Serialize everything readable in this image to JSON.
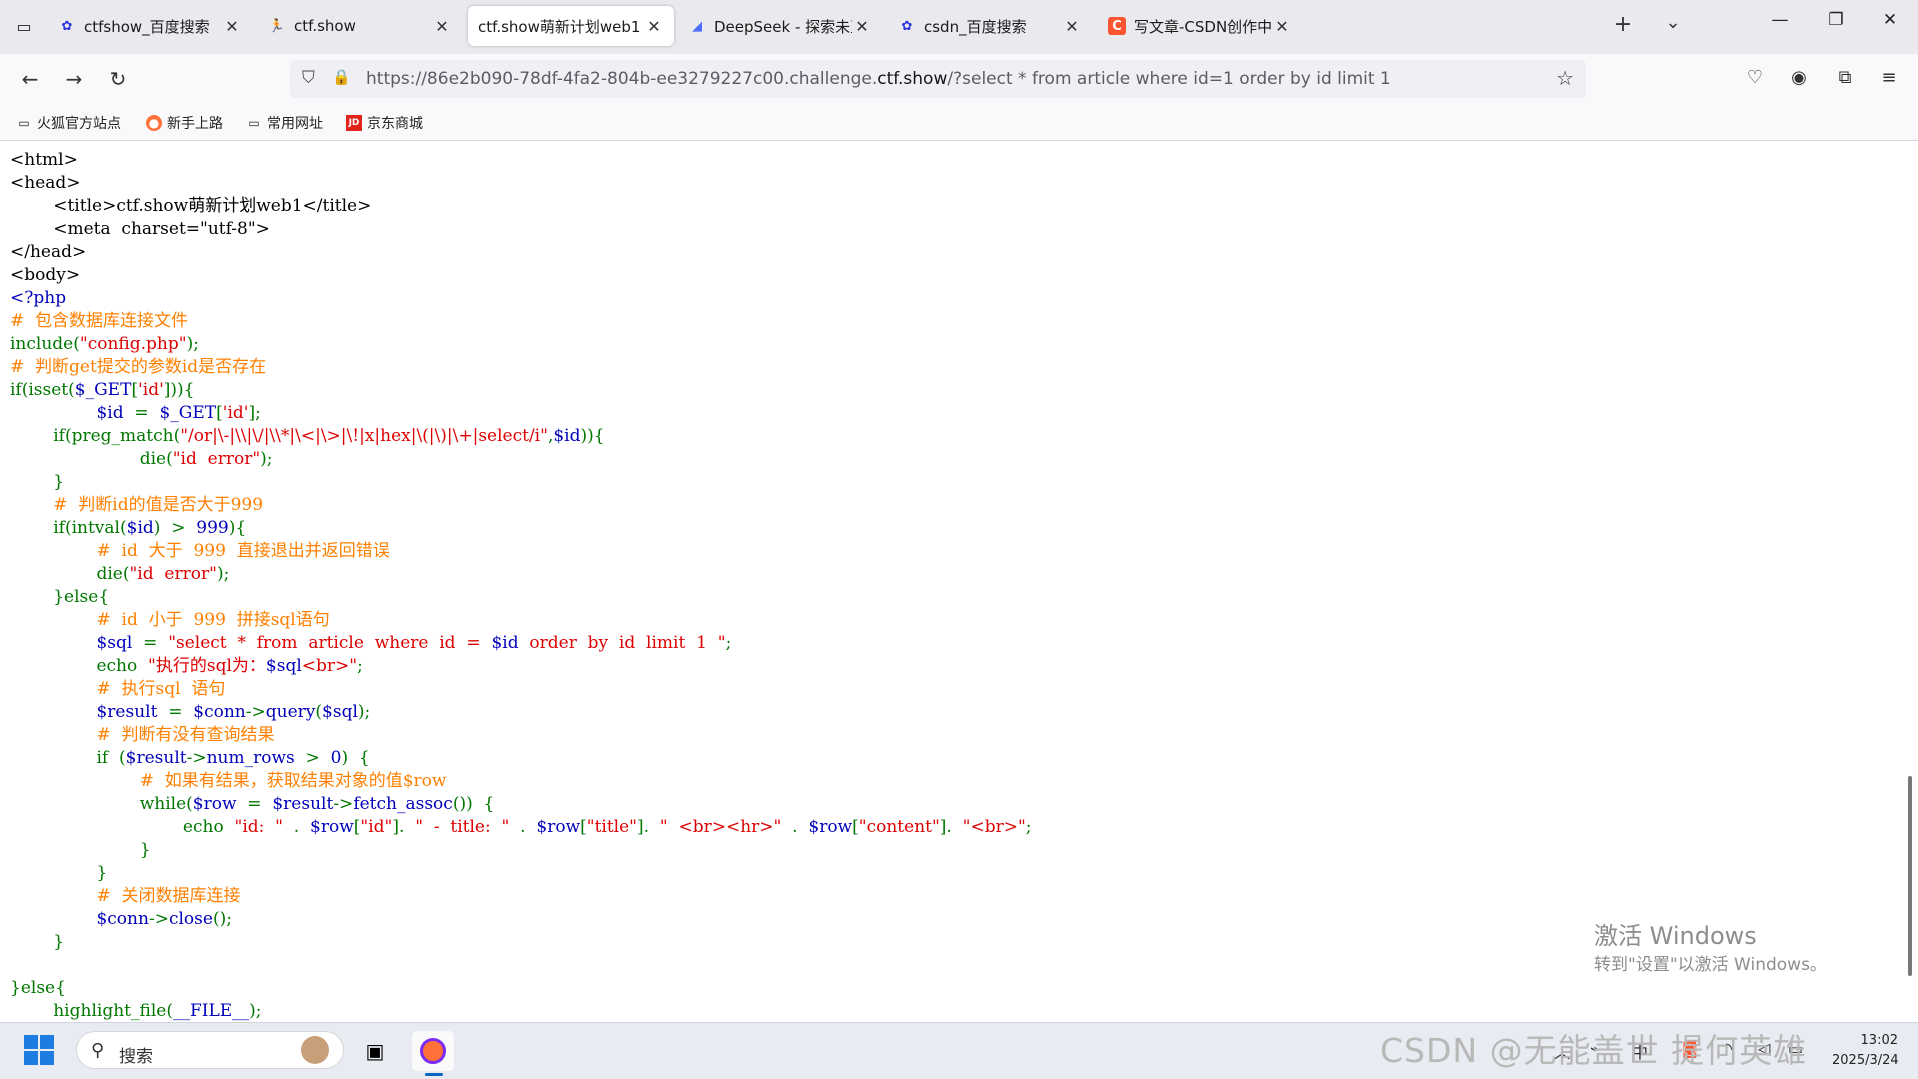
{
  "tabs": [
    {
      "title": "ctfshow_百度搜索",
      "icon": "baidu-paw-icon",
      "active": false
    },
    {
      "title": "ctf.show",
      "icon": "ctfshow-runner-icon",
      "active": false
    },
    {
      "title": "ctf.show萌新计划web1",
      "icon": "",
      "active": true
    },
    {
      "title": "DeepSeek - 探索未至之境",
      "icon": "deepseek-whale-icon",
      "active": false
    },
    {
      "title": "csdn_百度搜索",
      "icon": "baidu-paw-icon",
      "active": false
    },
    {
      "title": "写文章-CSDN创作中心",
      "icon": "csdn-c-icon",
      "active": false
    }
  ],
  "url": {
    "prefix": "https://86e2b090-78df-4fa2-804b-ee3279227c00.challenge.",
    "domain": "ctf.show",
    "suffix": "/?select * from article where id=1 order by id limit 1"
  },
  "bookmarks": [
    {
      "label": "火狐官方站点",
      "icon": "folder-icon"
    },
    {
      "label": "新手上路",
      "icon": "firefox-icon"
    },
    {
      "label": "常用网址",
      "icon": "folder-icon"
    },
    {
      "label": "京东商城",
      "icon": "jd-icon"
    }
  ],
  "code_lines": [
    [
      [
        "def",
        "<html>"
      ]
    ],
    [
      [
        "def",
        "<head>"
      ]
    ],
    [
      [
        "def",
        "        <title>ctf.show萌新计划web1</title>"
      ]
    ],
    [
      [
        "def",
        "        <meta  charset=\"utf-8\">"
      ]
    ],
    [
      [
        "def",
        "</head>"
      ]
    ],
    [
      [
        "def",
        "<body>"
      ]
    ],
    [
      [
        "var",
        "<?php"
      ]
    ],
    [
      [
        "cmt",
        "#  包含数据库连接文件"
      ]
    ],
    [
      [
        "kw",
        "include("
      ],
      [
        "str",
        "\"config.php\""
      ],
      [
        "kw",
        ");"
      ]
    ],
    [
      [
        "cmt",
        "#  判断get提交的参数id是否存在"
      ]
    ],
    [
      [
        "kw",
        "if(isset("
      ],
      [
        "var",
        "$_GET"
      ],
      [
        "kw",
        "["
      ],
      [
        "str",
        "'id'"
      ],
      [
        "kw",
        "])){"
      ]
    ],
    [
      [
        "kw",
        "                "
      ],
      [
        "var",
        "$id"
      ],
      [
        "kw",
        "  =  "
      ],
      [
        "var",
        "$_GET"
      ],
      [
        "kw",
        "["
      ],
      [
        "str",
        "'id'"
      ],
      [
        "kw",
        "];"
      ]
    ],
    [
      [
        "kw",
        "        if(preg_match("
      ],
      [
        "str",
        "\"/or|\\-|\\\\|\\/|\\\\*|\\<|\\>|\\!|x|hex|\\(|\\)|\\+|select/i\""
      ],
      [
        "kw",
        ","
      ],
      [
        "var",
        "$id"
      ],
      [
        "kw",
        ")){"
      ]
    ],
    [
      [
        "kw",
        "                        die("
      ],
      [
        "str",
        "\"id  error\""
      ],
      [
        "kw",
        ");"
      ]
    ],
    [
      [
        "kw",
        "        }"
      ]
    ],
    [
      [
        "cmt",
        "        #  判断id的值是否大于999"
      ]
    ],
    [
      [
        "kw",
        "        if(intval("
      ],
      [
        "var",
        "$id"
      ],
      [
        "kw",
        ")  >  "
      ],
      [
        "var",
        "999"
      ],
      [
        "kw",
        "){"
      ]
    ],
    [
      [
        "cmt",
        "                #  id  大于  999  直接退出并返回错误"
      ]
    ],
    [
      [
        "kw",
        "                die("
      ],
      [
        "str",
        "\"id  error\""
      ],
      [
        "kw",
        ");"
      ]
    ],
    [
      [
        "kw",
        "        }else{"
      ]
    ],
    [
      [
        "cmt",
        "                #  id  小于  999  拼接sql语句"
      ]
    ],
    [
      [
        "kw",
        "                "
      ],
      [
        "var",
        "$sql"
      ],
      [
        "kw",
        "  =  "
      ],
      [
        "str",
        "\"select  *  from  article  where  id  =  "
      ],
      [
        "var",
        "$id"
      ],
      [
        "str",
        "  order  by  id  limit  1  \""
      ],
      [
        "kw",
        ";"
      ]
    ],
    [
      [
        "kw",
        "                echo  "
      ],
      [
        "str",
        "\"执行的sql为："
      ],
      [
        "var",
        "$sql"
      ],
      [
        "str",
        "<br>\""
      ],
      [
        "kw",
        ";"
      ]
    ],
    [
      [
        "cmt",
        "                #  执行sql  语句"
      ]
    ],
    [
      [
        "kw",
        "                "
      ],
      [
        "var",
        "$result"
      ],
      [
        "kw",
        "  =  "
      ],
      [
        "var",
        "$conn"
      ],
      [
        "kw",
        "->"
      ],
      [
        "var",
        "query"
      ],
      [
        "kw",
        "("
      ],
      [
        "var",
        "$sql"
      ],
      [
        "kw",
        ");"
      ]
    ],
    [
      [
        "cmt",
        "                #  判断有没有查询结果"
      ]
    ],
    [
      [
        "kw",
        "                if  ("
      ],
      [
        "var",
        "$result"
      ],
      [
        "kw",
        "->"
      ],
      [
        "var",
        "num_rows"
      ],
      [
        "kw",
        "  >  "
      ],
      [
        "var",
        "0"
      ],
      [
        "kw",
        ")  {"
      ]
    ],
    [
      [
        "cmt",
        "                        #  如果有结果，获取结果对象的值$row"
      ]
    ],
    [
      [
        "kw",
        "                        while("
      ],
      [
        "var",
        "$row"
      ],
      [
        "kw",
        "  =  "
      ],
      [
        "var",
        "$result"
      ],
      [
        "kw",
        "->"
      ],
      [
        "var",
        "fetch_assoc"
      ],
      [
        "kw",
        "())  {"
      ]
    ],
    [
      [
        "kw",
        "                                echo  "
      ],
      [
        "str",
        "\"id:  \""
      ],
      [
        "kw",
        "  .  "
      ],
      [
        "var",
        "$row"
      ],
      [
        "kw",
        "["
      ],
      [
        "str",
        "\"id\""
      ],
      [
        "kw",
        "].  "
      ],
      [
        "str",
        "\"  -  title:  \""
      ],
      [
        "kw",
        "  .  "
      ],
      [
        "var",
        "$row"
      ],
      [
        "kw",
        "["
      ],
      [
        "str",
        "\"title\""
      ],
      [
        "kw",
        "].  "
      ],
      [
        "str",
        "\"  <br><hr>\""
      ],
      [
        "kw",
        "  .  "
      ],
      [
        "var",
        "$row"
      ],
      [
        "kw",
        "["
      ],
      [
        "str",
        "\"content\""
      ],
      [
        "kw",
        "].  "
      ],
      [
        "str",
        "\"<br>\""
      ],
      [
        "kw",
        ";"
      ]
    ],
    [
      [
        "kw",
        "                        }"
      ]
    ],
    [
      [
        "kw",
        "                }"
      ]
    ],
    [
      [
        "cmt",
        "                #  关闭数据库连接"
      ]
    ],
    [
      [
        "kw",
        "                "
      ],
      [
        "var",
        "$conn"
      ],
      [
        "kw",
        "->"
      ],
      [
        "var",
        "close"
      ],
      [
        "kw",
        "();"
      ]
    ],
    [
      [
        "kw",
        "        }"
      ]
    ],
    [
      [
        "kw",
        ""
      ]
    ],
    [
      [
        "kw",
        "}else{"
      ]
    ],
    [
      [
        "kw",
        "        highlight_file("
      ],
      [
        "var",
        "__FILE__"
      ],
      [
        "kw",
        ");"
      ]
    ]
  ],
  "watermark": {
    "line1": "激活 Windows",
    "line2": "转到\"设置\"以激活 Windows。"
  },
  "taskbar": {
    "search_placeholder": "搜索",
    "csdn_watermark": "CSDN @无能盖世  提何英雄",
    "time": "13:02",
    "date": "2025/3/24"
  },
  "colors": {
    "keyword": "#007700",
    "string": "#dd0000",
    "comment": "#ff8000",
    "variable": "#0000bb"
  }
}
